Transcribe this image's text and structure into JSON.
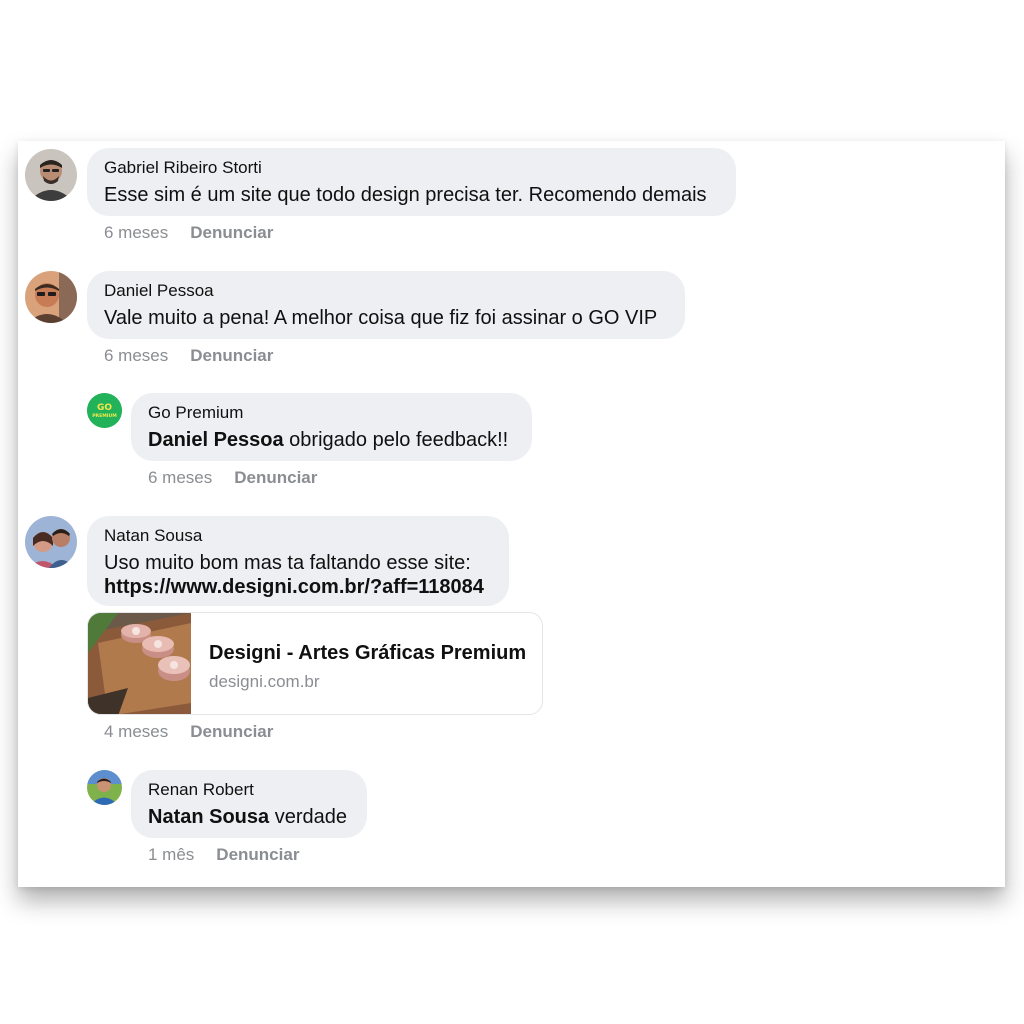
{
  "comments": [
    {
      "author": "Gabriel Ribeiro Storti",
      "text": "Esse sim é um site que todo design precisa ter. Recomendo demais",
      "time": "6 meses",
      "report": "Denunciar"
    },
    {
      "author": "Daniel Pessoa",
      "text": "Vale muito a pena! A melhor coisa que fiz foi assinar o GO VIP",
      "time": "6 meses",
      "report": "Denunciar",
      "reply": {
        "author": "Go Premium",
        "avatar_text": "GO PREMIUM",
        "mention": "Daniel Pessoa",
        "text": " obrigado pelo feedback!!",
        "time": "6 meses",
        "report": "Denunciar"
      }
    },
    {
      "author": "Natan Sousa",
      "text_line1": "Uso muito bom mas ta faltando esse site:",
      "link_text": "https://www.designi.com.br/?aff=118084",
      "preview": {
        "title": "Designi - Artes Gráficas Premium",
        "domain": "designi.com.br",
        "image": "food-photo"
      },
      "time": "4 meses",
      "report": "Denunciar",
      "reply": {
        "author": "Renan Robert",
        "mention": "Natan Sousa",
        "text": " verdade",
        "time": "1 mês",
        "report": "Denunciar"
      }
    }
  ],
  "colors": {
    "bubble": "#edeff2",
    "meta": "#8a8d91",
    "brand_green": "#22b25a"
  }
}
